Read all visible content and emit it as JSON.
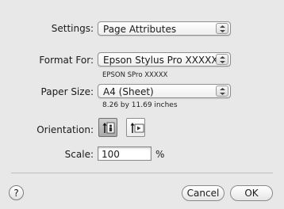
{
  "settings": {
    "label": "Settings:",
    "value": "Page Attributes"
  },
  "format_for": {
    "label": "Format For:",
    "value": "Epson Stylus Pro XXXXX",
    "sub_text": "EPSON SPro XXXXX"
  },
  "paper_size": {
    "label": "Paper Size:",
    "value": "A4 (Sheet)",
    "dimensions": "8.26 by 11.69 inches"
  },
  "orientation": {
    "label": "Orientation:",
    "selected": "portrait"
  },
  "scale": {
    "label": "Scale:",
    "value": "100",
    "unit": "%"
  },
  "footer": {
    "help_label": "?",
    "cancel_label": "Cancel",
    "ok_label": "OK"
  }
}
